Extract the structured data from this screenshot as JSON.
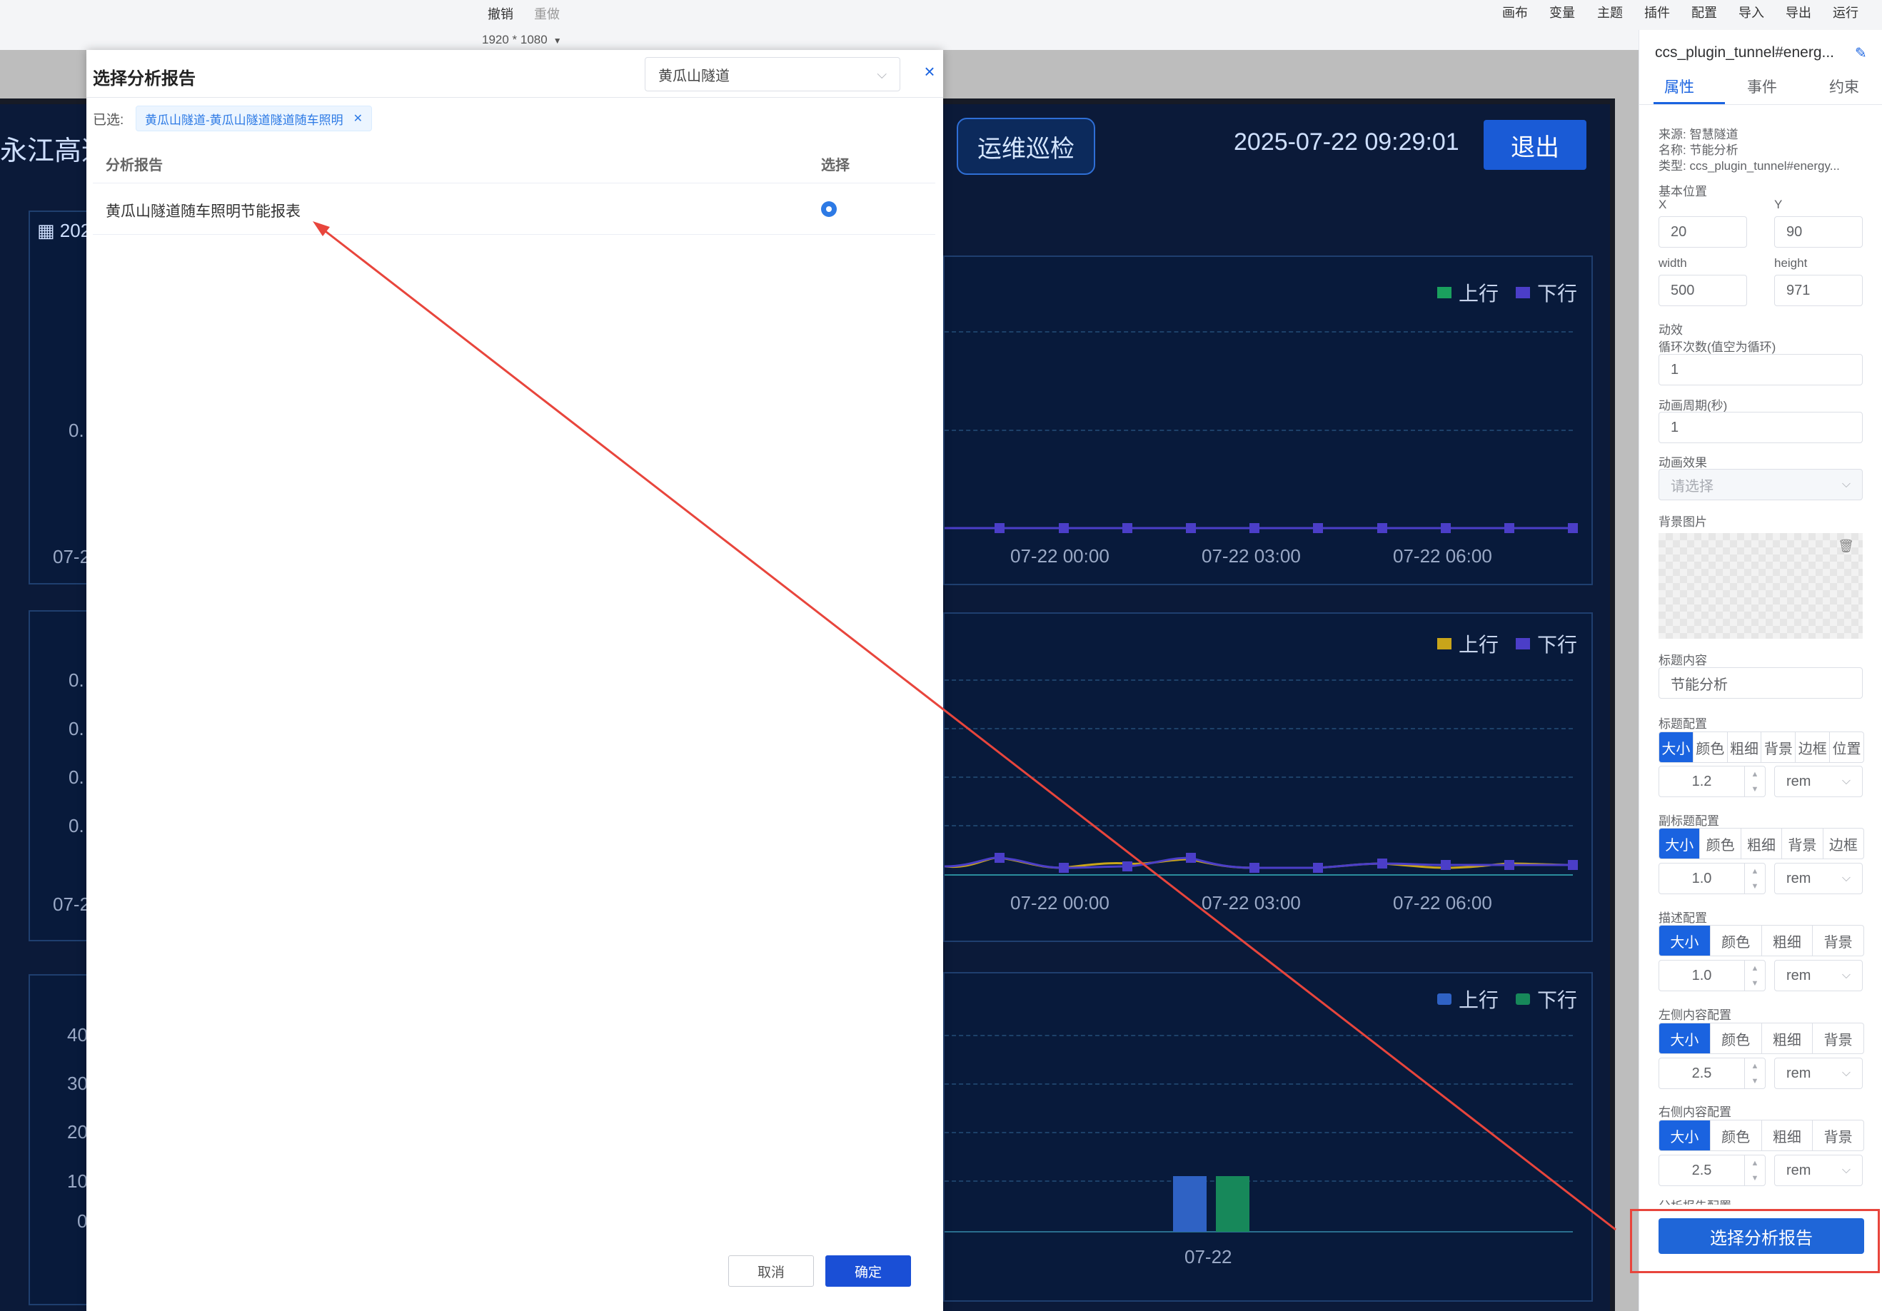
{
  "toolbar": {
    "undo": "撤销",
    "redo": "重做",
    "resolution": "1920 * 1080",
    "menu": [
      "画布",
      "变量",
      "主题",
      "插件",
      "配置",
      "导入",
      "导出",
      "运行"
    ]
  },
  "dashboard": {
    "left_title": "永江高速",
    "patrol_button": "运维巡检",
    "datetime": "2025-07-22 09:29:01",
    "exit_button": "退出",
    "left_partial_labels": [
      "202",
      "0.",
      "07-2",
      "0.",
      "0.",
      "0.",
      "0.",
      "07-2",
      "40",
      "30",
      "20",
      "10",
      "0"
    ],
    "charts": [
      {
        "legend": [
          "上行",
          "下行"
        ],
        "legend_colors": [
          "#1aa05e",
          "#4b3ec8"
        ],
        "x_ticks": [
          "07-22 00:00",
          "07-22 03:00",
          "07-22 06:00"
        ]
      },
      {
        "legend": [
          "上行",
          "下行"
        ],
        "legend_colors": [
          "#c9a51a",
          "#4b3ec8"
        ],
        "x_ticks": [
          "07-22 00:00",
          "07-22 03:00",
          "07-22 06:00"
        ]
      },
      {
        "legend": [
          "上行",
          "下行"
        ],
        "legend_colors": [
          "#2f62c4",
          "#17885a"
        ],
        "x_ticks": [
          "07-22"
        ]
      }
    ]
  },
  "props": {
    "component_name": "ccs_plugin_tunnel#energ...",
    "tabs": [
      "属性",
      "事件",
      "约束"
    ],
    "source": "来源: 智慧隧道",
    "name": "名称: 节能分析",
    "type": "类型: ccs_plugin_tunnel#energy...",
    "basic_position": "基本位置",
    "x_label": "X",
    "x_value": "20",
    "y_label": "Y",
    "y_value": "90",
    "width_label": "width",
    "width_value": "500",
    "height_label": "height",
    "height_value": "971",
    "animation": "动效",
    "loop_label": "循环次数(值空为循环)",
    "loop_value": "1",
    "period_label": "动画周期(秒)",
    "period_value": "1",
    "effect_label": "动画效果",
    "effect_placeholder": "请选择",
    "bg_label": "背景图片",
    "title_content_label": "标题内容",
    "title_content_value": "节能分析",
    "title_config_label": "标题配置",
    "title_config_segments": [
      "大小",
      "颜色",
      "粗细",
      "背景",
      "边框",
      "位置"
    ],
    "title_size": "1.2",
    "subtitle_config_label": "副标题配置",
    "subtitle_segments": [
      "大小",
      "颜色",
      "粗细",
      "背景",
      "边框"
    ],
    "subtitle_size": "1.0",
    "desc_config_label": "描述配置",
    "desc_segments": [
      "大小",
      "颜色",
      "粗细",
      "背景"
    ],
    "desc_size": "1.0",
    "left_content_label": "左侧内容配置",
    "left_segments": [
      "大小",
      "颜色",
      "粗细",
      "背景"
    ],
    "left_size": "2.5",
    "right_content_label": "右侧内容配置",
    "right_segments": [
      "大小",
      "颜色",
      "粗细",
      "背景"
    ],
    "right_size": "2.5",
    "unit": "rem",
    "report_config_label": "分析报告配置",
    "select_report_button": "选择分析报告"
  },
  "modal": {
    "title": "选择分析报告",
    "tunnel_select": "黄瓜山隧道",
    "close": "×",
    "selected_label": "已选:",
    "selected_tag": "黄瓜山隧道-黄瓜山隧道隧道随车照明",
    "col_report": "分析报告",
    "col_choose": "选择",
    "rows": [
      {
        "name": "黄瓜山隧道随车照明节能报表",
        "selected": true
      }
    ],
    "cancel": "取消",
    "confirm": "确定"
  },
  "colors": {
    "accent": "#1a63e0",
    "annotation": "#e8453c",
    "dashboard_bg": "#0b1a39"
  }
}
